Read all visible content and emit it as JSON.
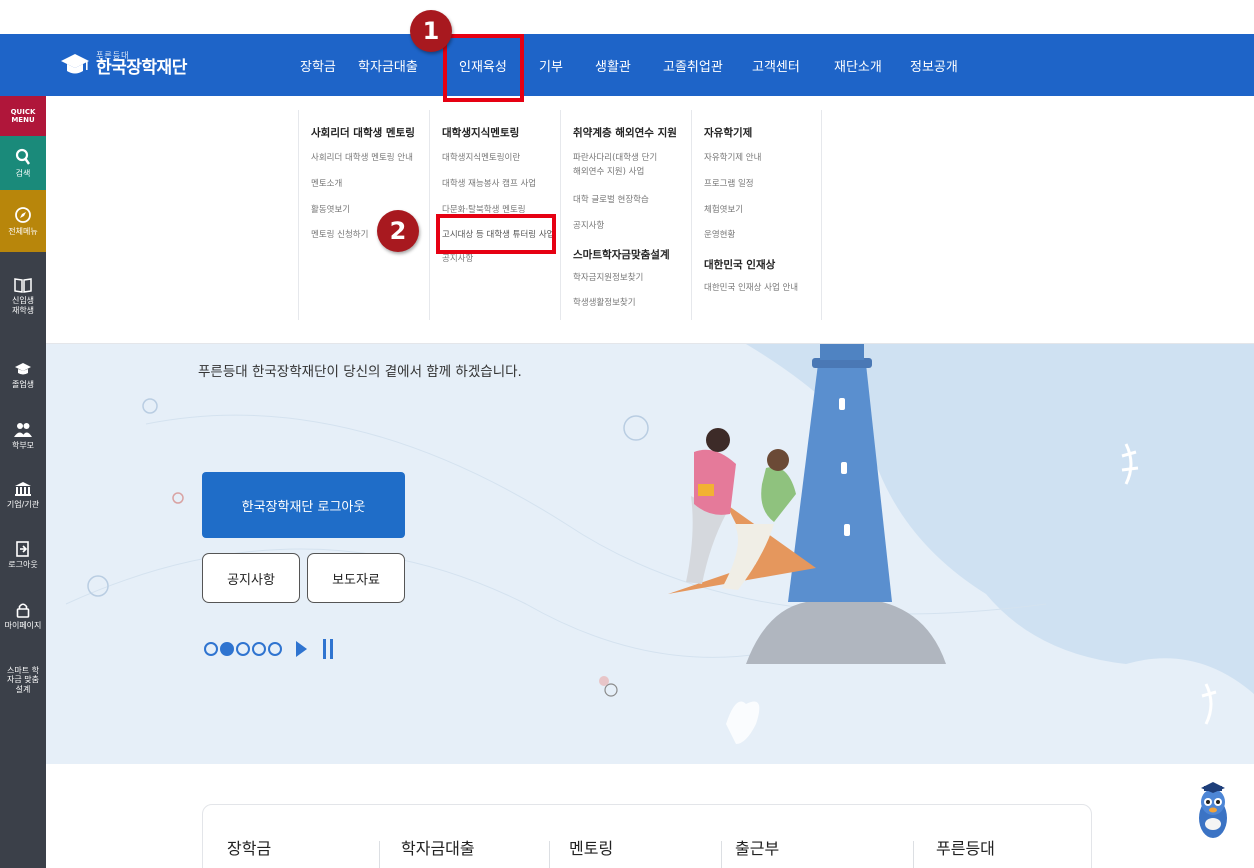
{
  "header": {
    "logo_sub": "푸른등대",
    "logo_main": "한국장학재단",
    "nav": [
      "장학금",
      "학자금대출",
      "인재육성",
      "기부",
      "생활관",
      "고졸취업관",
      "고객센터",
      "재단소개",
      "정보공개"
    ]
  },
  "quick_menu": {
    "title": "QUICK MENU",
    "items": [
      {
        "icon": "search-icon",
        "label": "검색"
      },
      {
        "icon": "compass-icon",
        "label": "전체메뉴"
      },
      {
        "icon": "book-icon",
        "label": "신입생 재학생"
      },
      {
        "icon": "graduation-cap-icon",
        "label": "졸업생"
      },
      {
        "icon": "parents-icon",
        "label": "학부모"
      },
      {
        "icon": "institution-icon",
        "label": "기업/기관"
      },
      {
        "icon": "logout-icon",
        "label": "로그아웃"
      },
      {
        "icon": "lock-icon",
        "label": "마이페이지"
      },
      {
        "icon": "",
        "label": "스마트 학자금 맞춤설계"
      }
    ]
  },
  "mega_menu": {
    "col1": {
      "title": "사회리더 대학생 멘토링",
      "links": [
        "사회리더 대학생 멘토링 안내",
        "멘토소개",
        "활동엿보기",
        "멘토링 신청하기"
      ]
    },
    "col2": {
      "title": "대학생지식멘토링",
      "links": [
        "대학생지식멘토링이란",
        "대학생 재능봉사 캠프 사업",
        "다문화·탈북학생 멘토링",
        "고시대상 등 대학생 튜터링 사업",
        "공지사항"
      ]
    },
    "col3": {
      "title": "취약계층 해외연수 지원",
      "links": [
        "파란사다리(대학생 단기",
        "해외연수 지원) 사업",
        "대학 글로벌 현장학습",
        "공지사항"
      ],
      "title2": "스마트학자금맞춤설계",
      "links2": [
        "학자금지원정보찾기",
        "학생생활정보찾기"
      ]
    },
    "col4": {
      "title": "자유학기제",
      "links": [
        "자유학기제 안내",
        "프로그램 일정",
        "체험엿보기",
        "운영현황"
      ],
      "title2": "대한민국 인재상",
      "links2": [
        "대한민국 인재상 사업 안내"
      ]
    }
  },
  "hero": {
    "message": "푸른등대 한국장학재단이 당신의 곁에서 함께 하겠습니다.",
    "logout_button": "한국장학재단 로그아웃",
    "notice_button": "공지사항",
    "press_button": "보도자료",
    "slide_count": 5,
    "slide_active": 2
  },
  "bottom_tabs": [
    "장학금",
    "학자금대출",
    "멘토링",
    "출근부",
    "푸른등대"
  ],
  "annotations": {
    "badge1": "1",
    "badge2": "2"
  },
  "colors": {
    "header_blue": "#1e64c8",
    "quick_bg": "#3b4049",
    "quick_accent_red": "#b0163a",
    "quick_accent_green": "#1a8a7a",
    "quick_accent_gold": "#b8860b",
    "annotation_red": "#e60012"
  }
}
